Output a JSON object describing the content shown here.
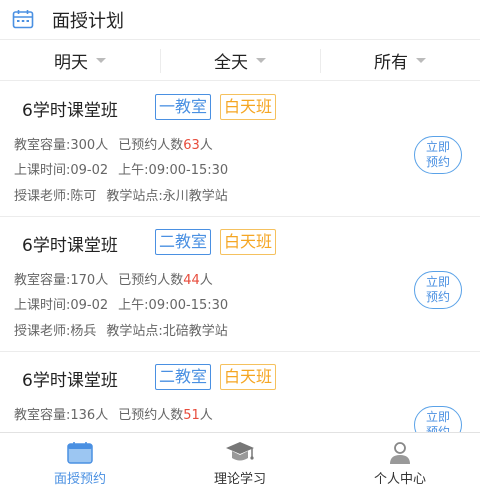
{
  "header": {
    "title": "面授计划"
  },
  "filters": [
    {
      "label": "明天"
    },
    {
      "label": "全天"
    },
    {
      "label": "所有"
    }
  ],
  "courses": [
    {
      "title": "6学时课堂班",
      "room": "一教室",
      "shift": "白天班",
      "capacity_label": "教室容量:",
      "capacity": "300人",
      "booked_label": "已预约人数",
      "booked": "63",
      "booked_unit": "人",
      "date_label": "上课时间:",
      "date": "09-02",
      "time": "上午:09:00-15:30",
      "teacher_label": "授课老师:",
      "teacher": "陈可",
      "site_label": "教学站点:",
      "site": "永川教学站",
      "btn_line1": "立即",
      "btn_line2": "预约"
    },
    {
      "title": "6学时课堂班",
      "room": "二教室",
      "shift": "白天班",
      "capacity_label": "教室容量:",
      "capacity": "170人",
      "booked_label": "已预约人数",
      "booked": "44",
      "booked_unit": "人",
      "date_label": "上课时间:",
      "date": "09-02",
      "time": "上午:09:00-15:30",
      "teacher_label": "授课老师:",
      "teacher": "杨兵",
      "site_label": "教学站点:",
      "site": "北碚教学站",
      "btn_line1": "立即",
      "btn_line2": "预约"
    },
    {
      "title": "6学时课堂班",
      "room": "二教室",
      "shift": "白天班",
      "capacity_label": "教室容量:",
      "capacity": "136人",
      "booked_label": "已预约人数",
      "booked": "51",
      "booked_unit": "人",
      "btn_line1": "立即",
      "btn_line2": "预约"
    }
  ],
  "tabs": [
    {
      "label": "面授预约",
      "icon": "calendar-icon",
      "active": true
    },
    {
      "label": "理论学习",
      "icon": "graduation-cap-icon",
      "active": false
    },
    {
      "label": "个人中心",
      "icon": "person-icon",
      "active": false
    }
  ],
  "colors": {
    "accent": "#4a90e2",
    "tag_orange": "#f5a623",
    "highlight_red": "#e74c3c"
  }
}
